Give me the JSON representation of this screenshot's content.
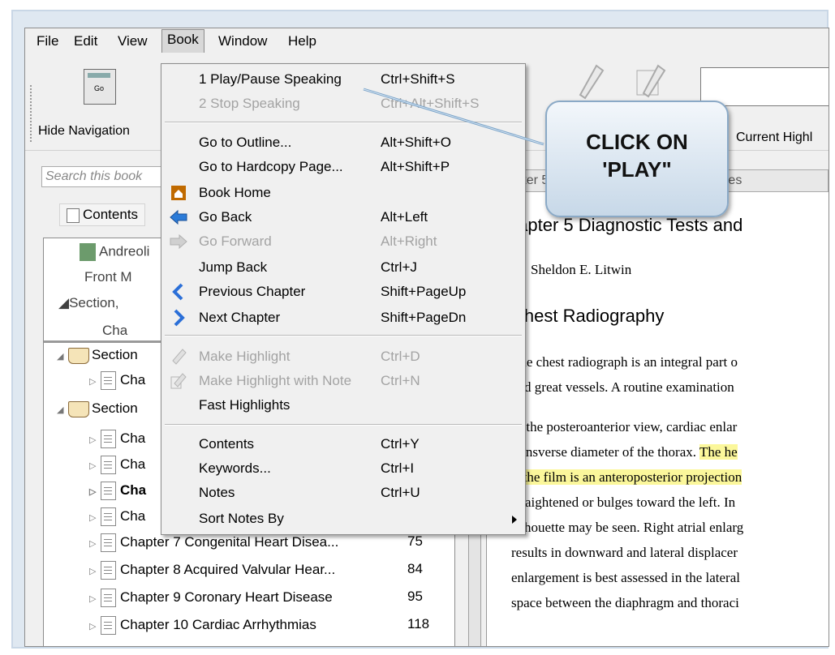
{
  "menubar": {
    "items": [
      "File",
      "Edit",
      "View",
      "Book",
      "Window",
      "Help"
    ]
  },
  "toolbar": {
    "hide_navigation": "Hide Navigation",
    "current_highlight": "Current Highl",
    "go_icon_text": "Go"
  },
  "navigation": {
    "search_placeholder": "Search this book",
    "contents_tab": "Contents",
    "ghost_items": [
      "Andreoli",
      "Front M",
      "Section,",
      "Cha"
    ],
    "tree": [
      {
        "type": "section",
        "label": "Section",
        "page": ""
      },
      {
        "type": "chapter",
        "label": "Cha",
        "page": ""
      },
      {
        "type": "section",
        "label": "Section",
        "page": ""
      },
      {
        "type": "chapter",
        "label": "Cha",
        "page": ""
      },
      {
        "type": "chapter",
        "label": "Cha",
        "page": ""
      },
      {
        "type": "chapter",
        "label": "Cha",
        "page": "",
        "bold": true
      },
      {
        "type": "chapter",
        "label": "Cha",
        "page": ""
      },
      {
        "type": "chapter",
        "label": "Chapter 7 Congenital Heart Disea...",
        "page": "75"
      },
      {
        "type": "chapter",
        "label": "Chapter 8 Acquired Valvular Hear...",
        "page": "84"
      },
      {
        "type": "chapter",
        "label": "Chapter 9 Coronary Heart Disease",
        "page": "95"
      },
      {
        "type": "chapter",
        "label": "Chapter 10 Cardiac Arrhythmias",
        "page": "118"
      }
    ]
  },
  "content": {
    "tab_title": "Chapter 5 Diagnostic Tests and Procedures",
    "title": "Chapter 5  Diagnostic Tests and",
    "author": "Sheldon E. Litwin",
    "heading": "Chest Radiography",
    "para1": [
      "The chest radiograph is an integral part o",
      "and great vessels. A routine examination"
    ],
    "para2_pre": "In the posteroanterior view, cardiac enlar",
    "para2_l2a": "transverse diameter of the thorax. ",
    "para2_l2b": "The he",
    "para2_l3": "if the film is an anteroposterior projection",
    "para2_rest": [
      "straightened or bulges toward the left. In",
      "silhouette may be seen. Right atrial enlarg",
      "results in downward and lateral displacer",
      "enlargement is best assessed in the lateral",
      "space between the diaphragm and thoraci"
    ]
  },
  "book_menu": {
    "items": [
      {
        "label": "1 Play/Pause Speaking",
        "shortcut": "Ctrl+Shift+S",
        "enabled": true,
        "icon": ""
      },
      {
        "label": "2 Stop Speaking",
        "shortcut": "Ctrl+Alt+Shift+S",
        "enabled": false,
        "icon": ""
      },
      {
        "label": "Go to Outline...",
        "shortcut": "Alt+Shift+O",
        "enabled": true,
        "icon": ""
      },
      {
        "label": "Go to Hardcopy Page...",
        "shortcut": "Alt+Shift+P",
        "enabled": true,
        "icon": ""
      },
      {
        "label": "Book Home",
        "shortcut": "",
        "enabled": true,
        "icon": "home-icon"
      },
      {
        "label": "Go Back",
        "shortcut": "Alt+Left",
        "enabled": true,
        "icon": "back-arrow-icon"
      },
      {
        "label": "Go Forward",
        "shortcut": "Alt+Right",
        "enabled": false,
        "icon": "forward-arrow-icon"
      },
      {
        "label": "Jump Back",
        "shortcut": "Ctrl+J",
        "enabled": true,
        "icon": ""
      },
      {
        "label": "Previous Chapter",
        "shortcut": "Shift+PageUp",
        "enabled": true,
        "icon": "previous-chapter-icon"
      },
      {
        "label": "Next Chapter",
        "shortcut": "Shift+PageDn",
        "enabled": true,
        "icon": "next-chapter-icon"
      },
      {
        "label": "Make Highlight",
        "shortcut": "Ctrl+D",
        "enabled": false,
        "icon": "highlighter-icon"
      },
      {
        "label": "Make Highlight with Note",
        "shortcut": "Ctrl+N",
        "enabled": false,
        "icon": "highlight-note-icon"
      },
      {
        "label": "Fast Highlights",
        "shortcut": "",
        "enabled": true,
        "icon": ""
      },
      {
        "label": "Contents",
        "shortcut": "Ctrl+Y",
        "enabled": true,
        "icon": ""
      },
      {
        "label": "Keywords...",
        "shortcut": "Ctrl+I",
        "enabled": true,
        "icon": ""
      },
      {
        "label": "Notes",
        "shortcut": "Ctrl+U",
        "enabled": true,
        "icon": ""
      },
      {
        "label": "Sort Notes By",
        "shortcut": "",
        "enabled": true,
        "icon": "submenu-arrow-icon"
      }
    ]
  },
  "callout": {
    "line1": "CLICK ON",
    "line2": "'PLAY\""
  },
  "colors": {
    "highlight": "#fbf79b",
    "menu_bg": "#f0f0f0",
    "disabled_text": "#a3a3a3",
    "callout_border": "#8aa9c6"
  }
}
